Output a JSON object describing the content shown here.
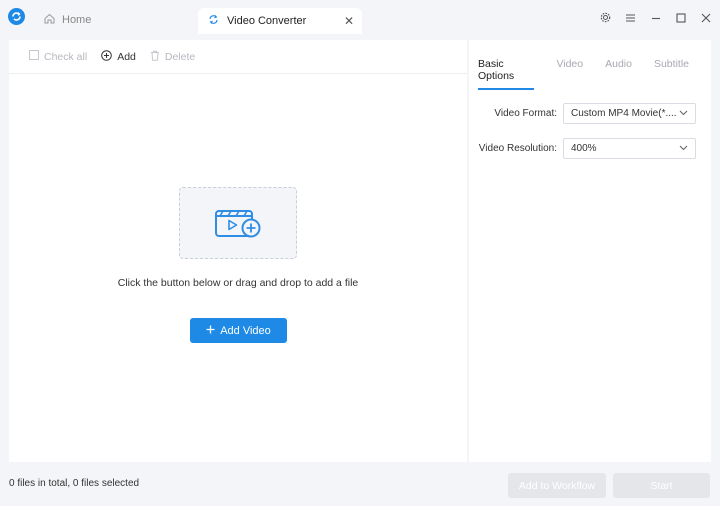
{
  "titlebar": {
    "home_tab_label": "Home",
    "active_tab_label": "Video Converter"
  },
  "toolbar": {
    "check_all_label": "Check all",
    "add_label": "Add",
    "delete_label": "Delete"
  },
  "drop_area": {
    "hint": "Click the button below or drag and drop to add a file",
    "add_video_label": "Add Video"
  },
  "options": {
    "tabs": [
      "Basic Options",
      "Video",
      "Audio",
      "Subtitle"
    ],
    "active_tab": "Basic Options",
    "video_format_label": "Video Format:",
    "video_format_value": "Custom MP4 Movie(*....",
    "video_resolution_label": "Video Resolution:",
    "video_resolution_value": "400%"
  },
  "status": {
    "files_text": "0 files in total, 0 files selected"
  },
  "actions": {
    "add_to_workflow_label": "Add to Workflow",
    "start_label": "Start"
  },
  "colors": {
    "accent": "#1e8ae6",
    "disabled_button": "#e4e6ea",
    "background": "#f4f5f8"
  }
}
